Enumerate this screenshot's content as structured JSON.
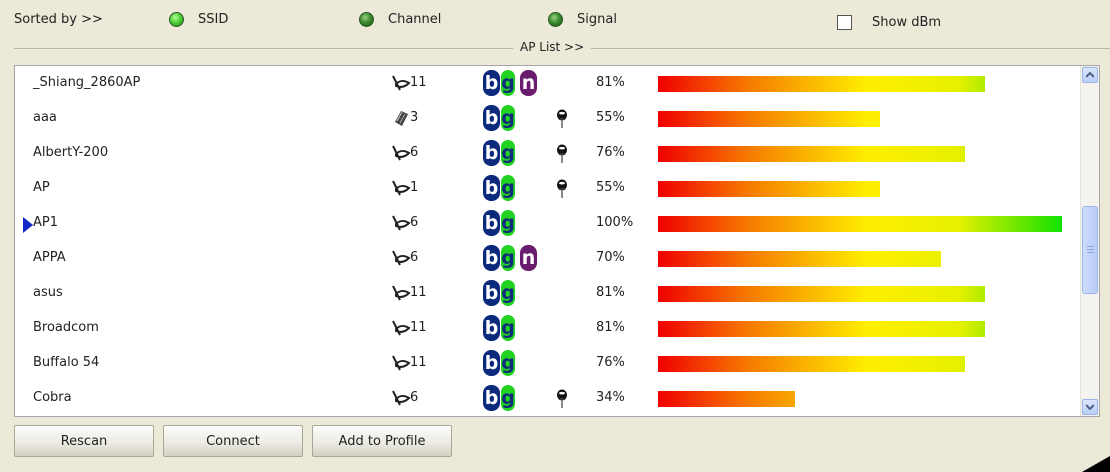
{
  "sort": {
    "label": "Sorted by >>",
    "options": [
      "SSID",
      "Channel",
      "Signal"
    ],
    "show_dbm_label": "Show dBm"
  },
  "ap_list_label": "AP List >>",
  "rows": [
    {
      "ssid": "_Shiang_2860AP",
      "channel": "11",
      "net_type": "infrastructure",
      "b": "b",
      "g": "g",
      "n": "n",
      "secured": false,
      "signal": "81%",
      "signal_value": 81,
      "selected": false
    },
    {
      "ssid": "aaa",
      "channel": "3",
      "net_type": "adhoc",
      "b": "b",
      "g": "g",
      "n": "",
      "secured": true,
      "signal": "55%",
      "signal_value": 55,
      "selected": false
    },
    {
      "ssid": "AlbertY-200",
      "channel": "6",
      "net_type": "infrastructure",
      "b": "b",
      "g": "g",
      "n": "",
      "secured": true,
      "signal": "76%",
      "signal_value": 76,
      "selected": false
    },
    {
      "ssid": "AP",
      "channel": "1",
      "net_type": "infrastructure",
      "b": "b",
      "g": "g",
      "n": "",
      "secured": true,
      "signal": "55%",
      "signal_value": 55,
      "selected": false
    },
    {
      "ssid": "AP1",
      "channel": "6",
      "net_type": "infrastructure",
      "b": "b",
      "g": "g",
      "n": "",
      "secured": false,
      "signal": "100%",
      "signal_value": 100,
      "selected": true
    },
    {
      "ssid": "APPA",
      "channel": "6",
      "net_type": "infrastructure",
      "b": "b",
      "g": "g",
      "n": "n",
      "secured": false,
      "signal": "70%",
      "signal_value": 70,
      "selected": false
    },
    {
      "ssid": "asus",
      "channel": "11",
      "net_type": "infrastructure",
      "b": "b",
      "g": "g",
      "n": "",
      "secured": false,
      "signal": "81%",
      "signal_value": 81,
      "selected": false
    },
    {
      "ssid": "Broadcom",
      "channel": "11",
      "net_type": "infrastructure",
      "b": "b",
      "g": "g",
      "n": "",
      "secured": false,
      "signal": "81%",
      "signal_value": 81,
      "selected": false
    },
    {
      "ssid": "Buffalo 54",
      "channel": "11",
      "net_type": "infrastructure",
      "b": "b",
      "g": "g",
      "n": "",
      "secured": false,
      "signal": "76%",
      "signal_value": 76,
      "selected": false
    },
    {
      "ssid": "Cobra",
      "channel": "6",
      "net_type": "infrastructure",
      "b": "b",
      "g": "g",
      "n": "",
      "secured": true,
      "signal": "34%",
      "signal_value": 34,
      "selected": false
    }
  ],
  "buttons": {
    "rescan": "Rescan",
    "connect": "Connect",
    "add_to_profile": "Add to Profile"
  },
  "colors": {
    "background": "#ece9d8",
    "badge_b": "#0b2a7c",
    "badge_g": "#22d322",
    "badge_n": "#6a1c6e",
    "selection_arrow": "#1426c8"
  }
}
